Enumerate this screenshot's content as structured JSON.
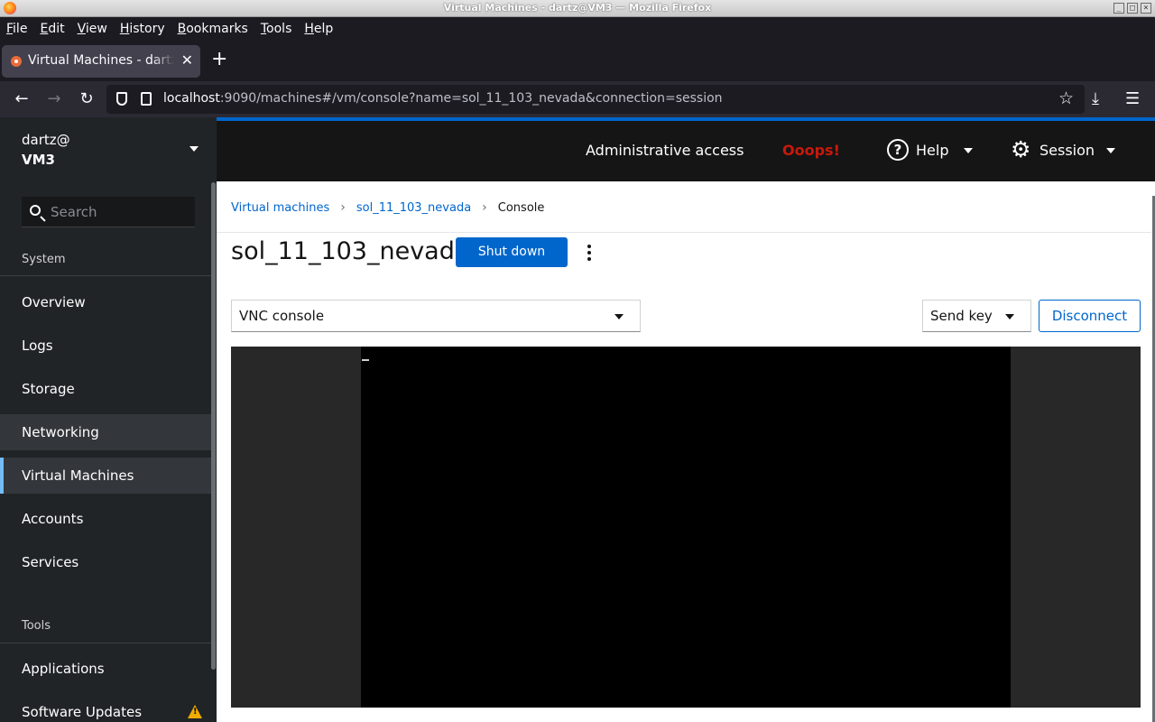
{
  "window": {
    "title": "Virtual Machines - dartz@VM3 — Mozilla Firefox"
  },
  "menubar": {
    "items": [
      "File",
      "Edit",
      "View",
      "History",
      "Bookmarks",
      "Tools",
      "Help"
    ]
  },
  "tabs": [
    {
      "title": "Virtual Machines - dartz@VM3"
    }
  ],
  "urlbar": {
    "host": "localhost",
    "rest": ":9090/machines#/vm/console?name=sol_11_103_nevada&connection=session"
  },
  "sidebar": {
    "user": "dartz@",
    "host": "VM3",
    "search_placeholder": "Search",
    "section_system": "System",
    "items": [
      "Overview",
      "Logs",
      "Storage",
      "Networking",
      "Virtual Machines",
      "Accounts",
      "Services"
    ],
    "section_tools": "Tools",
    "tools_items": [
      "Applications",
      "Software Updates"
    ],
    "active_item": "Virtual Machines"
  },
  "masthead": {
    "admin_access": "Administrative access",
    "oops": "Ooops!",
    "help": "Help",
    "session": "Session"
  },
  "breadcrumb": {
    "root": "Virtual machines",
    "vm": "sol_11_103_nevada",
    "current": "Console"
  },
  "vm": {
    "name": "sol_11_103_nevada",
    "shutdown_label": "Shut down",
    "console_type": "VNC console",
    "send_key_label": "Send key",
    "disconnect_label": "Disconnect"
  },
  "colors": {
    "accent": "#0066cc",
    "oops": "#c9190b",
    "active_indicator": "#73bcf7"
  },
  "icons": [
    "firefox-icon",
    "shield-icon",
    "star-icon",
    "download-icon",
    "menu-icon",
    "search-icon",
    "help-icon",
    "gear-icon",
    "kebab-icon",
    "warning-icon"
  ]
}
